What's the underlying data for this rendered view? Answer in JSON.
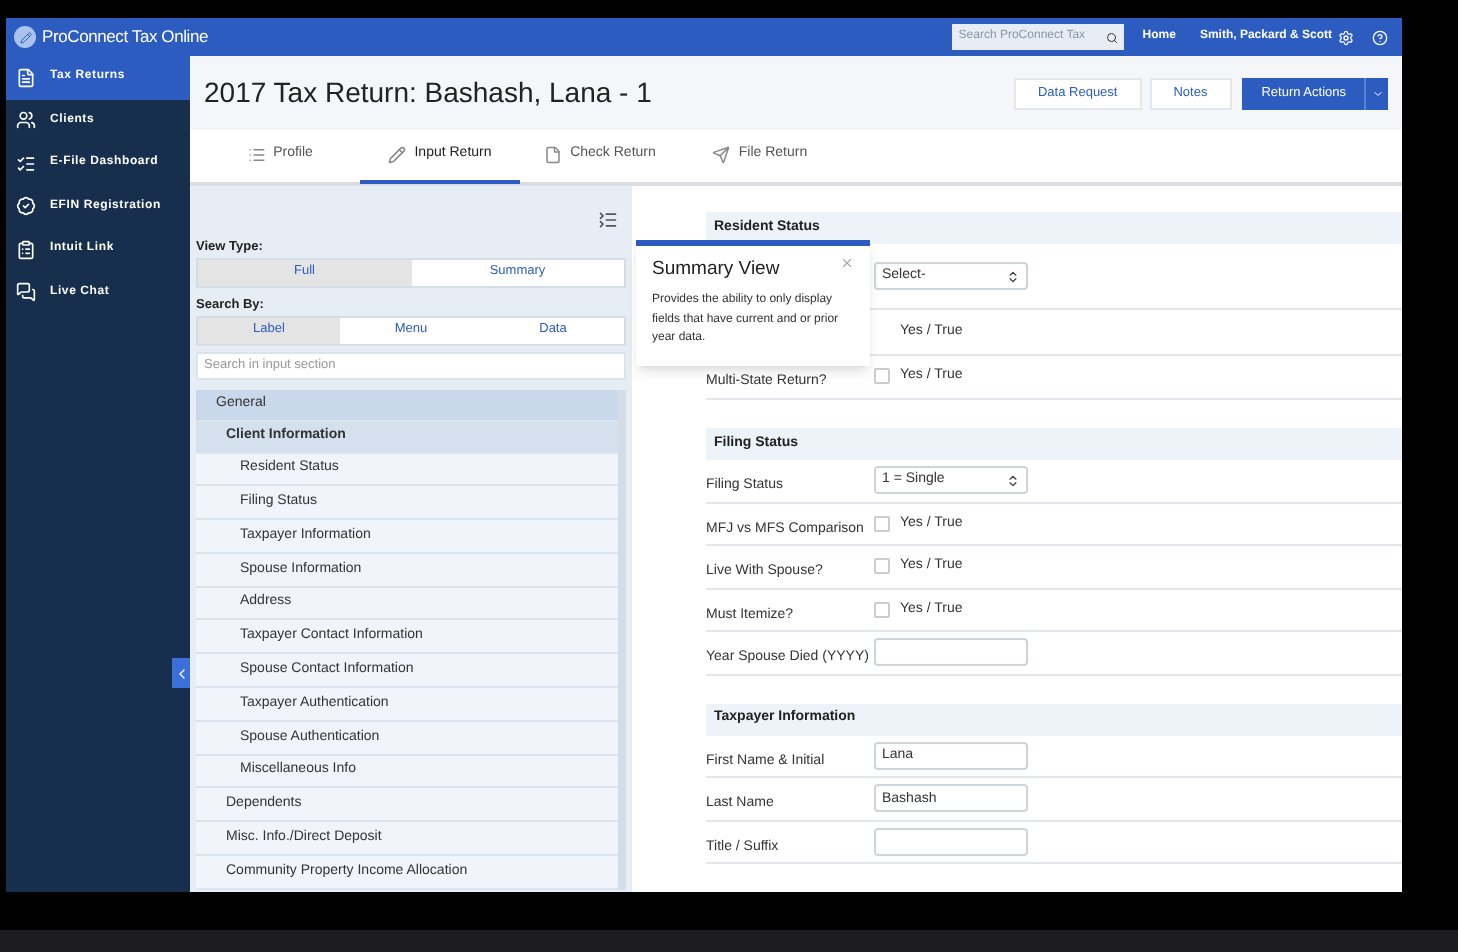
{
  "topbar": {
    "app_name": "ProConnect Tax Online",
    "search": {
      "placeholder": "Search ProConnect Tax"
    },
    "home": "Home",
    "firm": "Smith, Packard & Scott"
  },
  "sidebar": {
    "items": [
      {
        "label": "Tax Returns",
        "selected": true
      },
      {
        "label": "Clients",
        "selected": false
      },
      {
        "label": "E-File Dashboard",
        "selected": false
      },
      {
        "label": "EFIN Registration",
        "selected": false
      },
      {
        "label": "Intuit Link",
        "selected": false
      },
      {
        "label": "Live Chat",
        "selected": false
      }
    ]
  },
  "header": {
    "title": "2017 Tax Return: Bashash, Lana - 1",
    "buttons": [
      "Data Request",
      "Notes"
    ],
    "primary_button": "Return Actions"
  },
  "tabs": [
    {
      "label": "Profile",
      "selected": false
    },
    {
      "label": "Input Return",
      "selected": true
    },
    {
      "label": "Check Return",
      "selected": false
    },
    {
      "label": "File Return",
      "selected": false
    }
  ],
  "left_panel": {
    "view_type_label": "View Type:",
    "view_types": [
      {
        "label": "Full",
        "selected": true
      },
      {
        "label": "Summary",
        "selected": false
      }
    ],
    "search_by_label": "Search By:",
    "search_by": [
      {
        "label": "Label",
        "selected": true
      },
      {
        "label": "Menu",
        "selected": false
      },
      {
        "label": "Data",
        "selected": false
      }
    ],
    "search": {
      "placeholder": "Search in input section"
    },
    "tree": [
      {
        "label": "General",
        "children": [
          {
            "label": "Client Information",
            "selected": true,
            "children": [
              {
                "label": "Resident Status",
                "selected": false
              },
              {
                "label": "Filing Status",
                "selected": false
              },
              {
                "label": "Taxpayer Information",
                "selected": false
              },
              {
                "label": "Spouse Information",
                "selected": false
              },
              {
                "label": "Address",
                "selected": false
              },
              {
                "label": "Taxpayer Contact Information",
                "selected": false
              },
              {
                "label": "Spouse Contact Information",
                "selected": false
              },
              {
                "label": "Taxpayer Authentication",
                "selected": false
              },
              {
                "label": "Spouse Authentication",
                "selected": false
              },
              {
                "label": "Miscellaneous Info",
                "selected": false
              }
            ]
          },
          {
            "label": "Dependents",
            "selected": false
          },
          {
            "label": "Misc. Info./Direct Deposit",
            "selected": false
          },
          {
            "label": "Community Property Income Allocation",
            "selected": false
          }
        ]
      }
    ]
  },
  "form": {
    "sections": [
      {
        "title": "Resident Status",
        "fields": [
          {
            "kind": "select",
            "value": "Select-"
          },
          {
            "kind": "checkbox",
            "option": "Yes / True"
          },
          {
            "kind": "checkbox",
            "label": "Multi-State Return?",
            "option": "Yes / True",
            "checked": false
          }
        ]
      },
      {
        "title": "Filing Status",
        "fields": [
          {
            "kind": "select",
            "label": "Filing Status",
            "value": "1 = Single"
          },
          {
            "kind": "checkbox",
            "label": "MFJ vs MFS Comparison",
            "option": "Yes / True",
            "checked": false
          },
          {
            "kind": "checkbox",
            "label": "Live With Spouse?",
            "option": "Yes / True",
            "checked": false
          },
          {
            "kind": "checkbox",
            "label": "Must Itemize?",
            "option": "Yes / True",
            "checked": false
          },
          {
            "kind": "text",
            "label": "Year Spouse Died (YYYY)"
          }
        ]
      },
      {
        "title": "Taxpayer Information",
        "fields": [
          {
            "kind": "text",
            "label": "First Name & Initial",
            "value": "Lana"
          },
          {
            "kind": "text",
            "label": "Last Name",
            "value": "Bashash"
          },
          {
            "kind": "text",
            "label": "Title / Suffix"
          }
        ]
      }
    ]
  },
  "popover": {
    "title": "Summary View",
    "text": "Provides the ability to only display fields that have current and or prior year data."
  }
}
